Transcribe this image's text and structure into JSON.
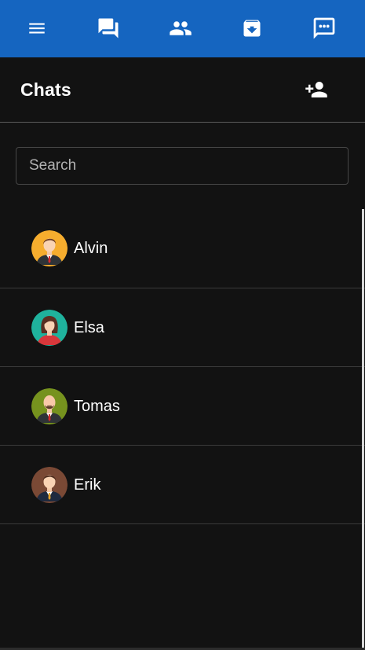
{
  "topnav": {
    "icons": [
      "menu-icon",
      "chat-bubbles-icon",
      "group-icon",
      "archive-icon",
      "message-dots-icon"
    ],
    "background": "#1565c0"
  },
  "header": {
    "title": "Chats",
    "add_icon": "add-person-icon"
  },
  "search": {
    "placeholder": "Search",
    "value": ""
  },
  "contacts": [
    {
      "name": "Alvin",
      "avatar_bg": "#f6ad2e"
    },
    {
      "name": "Elsa",
      "avatar_bg": "#1fb29d"
    },
    {
      "name": "Tomas",
      "avatar_bg": "#76921e"
    },
    {
      "name": "Erik",
      "avatar_bg": "#7a4935"
    }
  ]
}
